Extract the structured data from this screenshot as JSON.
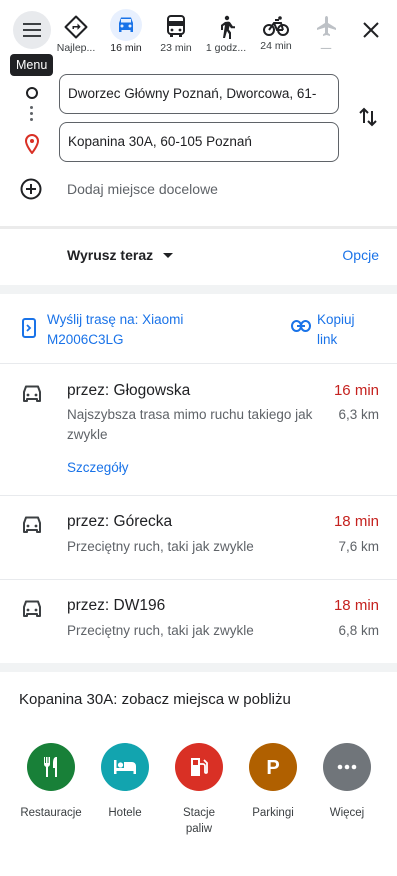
{
  "menu": {
    "tooltip": "Menu"
  },
  "travel_modes": [
    {
      "name": "best",
      "label": "Najlep..."
    },
    {
      "name": "drive",
      "label": "16 min"
    },
    {
      "name": "transit",
      "label": "23 min"
    },
    {
      "name": "walk",
      "label": "1 godz..."
    },
    {
      "name": "bike",
      "label": "24 min"
    },
    {
      "name": "flight",
      "label": "—"
    }
  ],
  "route_inputs": {
    "origin": "Dworzec Główny Poznań, Dworcowa, 61-",
    "destination": "Kopanina 30A, 60-105 Poznań",
    "add_destination": "Dodaj miejsce docelowe"
  },
  "depart": {
    "label": "Wyrusz teraz",
    "options": "Opcje"
  },
  "share": {
    "send_label": "Wyślij trasę na: Xiaomi M2006C3LG",
    "copy_label": "Kopiuj link"
  },
  "routes": [
    {
      "via": "przez: Głogowska",
      "time": "16 min",
      "desc": "Najszybsza trasa mimo ruchu takiego jak zwykle",
      "distance": "6,3 km",
      "details": "Szczegóły"
    },
    {
      "via": "przez: Górecka",
      "time": "18 min",
      "desc": "Przeciętny ruch, taki jak zwykle",
      "distance": "7,6 km"
    },
    {
      "via": "przez: DW196",
      "time": "18 min",
      "desc": "Przeciętny ruch, taki jak zwykle",
      "distance": "6,8 km"
    }
  ],
  "nearby": {
    "title": "Kopanina 30A: zobacz miejsca w pobliżu",
    "categories": [
      {
        "label": "Restauracje",
        "color": "#188038",
        "icon": "restaurant-icon"
      },
      {
        "label": "Hotele",
        "color": "#12a4af",
        "icon": "hotel-icon"
      },
      {
        "label": "Stacje paliw",
        "color": "#d93025",
        "icon": "gas-station-icon"
      },
      {
        "label": "Parkingi",
        "color": "#b06000",
        "icon": "parking-icon"
      },
      {
        "label": "Więcej",
        "color": "#70757a",
        "icon": "more-icon"
      }
    ]
  },
  "colors": {
    "accent": "#1a73e8",
    "time": "#c5221f"
  }
}
